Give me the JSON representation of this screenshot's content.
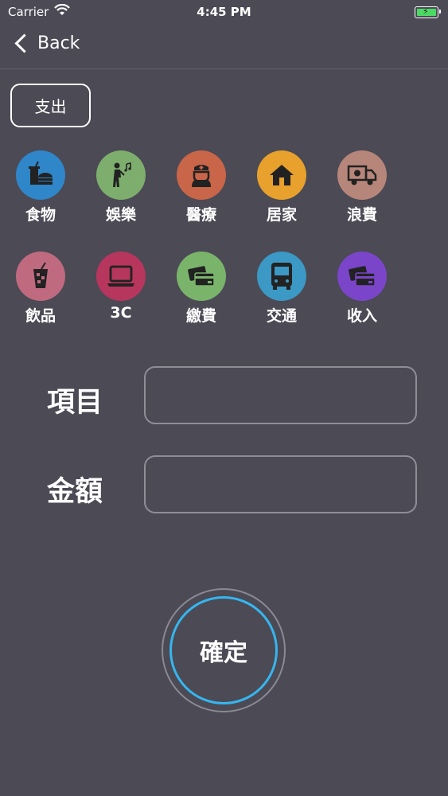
{
  "status_bar": {
    "carrier": "Carrier",
    "time": "4:45 PM"
  },
  "nav": {
    "back_label": "Back"
  },
  "type_toggle": {
    "label": "支出"
  },
  "categories": [
    {
      "name": "食物",
      "color": "#2f86c8",
      "icon": "food-icon"
    },
    {
      "name": "娛樂",
      "color": "#7dae6d",
      "icon": "entertainment-icon"
    },
    {
      "name": "醫療",
      "color": "#c96549",
      "icon": "medical-icon"
    },
    {
      "name": "居家",
      "color": "#e7a12c",
      "icon": "home-icon"
    },
    {
      "name": "浪費",
      "color": "#b7867a",
      "icon": "waste-truck-icon"
    },
    {
      "name": "飲品",
      "color": "#c06a80",
      "icon": "drink-icon"
    },
    {
      "name": "3C",
      "color": "#b7365e",
      "icon": "laptop-icon"
    },
    {
      "name": "繳費",
      "color": "#79b46a",
      "icon": "bill-card-icon"
    },
    {
      "name": "交通",
      "color": "#3c98c4",
      "icon": "bus-icon"
    },
    {
      "name": "收入",
      "color": "#7a45c9",
      "icon": "income-card-icon"
    }
  ],
  "form": {
    "item_label": "項目",
    "amount_label": "金額",
    "item_value": "",
    "amount_value": ""
  },
  "confirm": {
    "label": "確定",
    "accent": "#36b6ef"
  }
}
